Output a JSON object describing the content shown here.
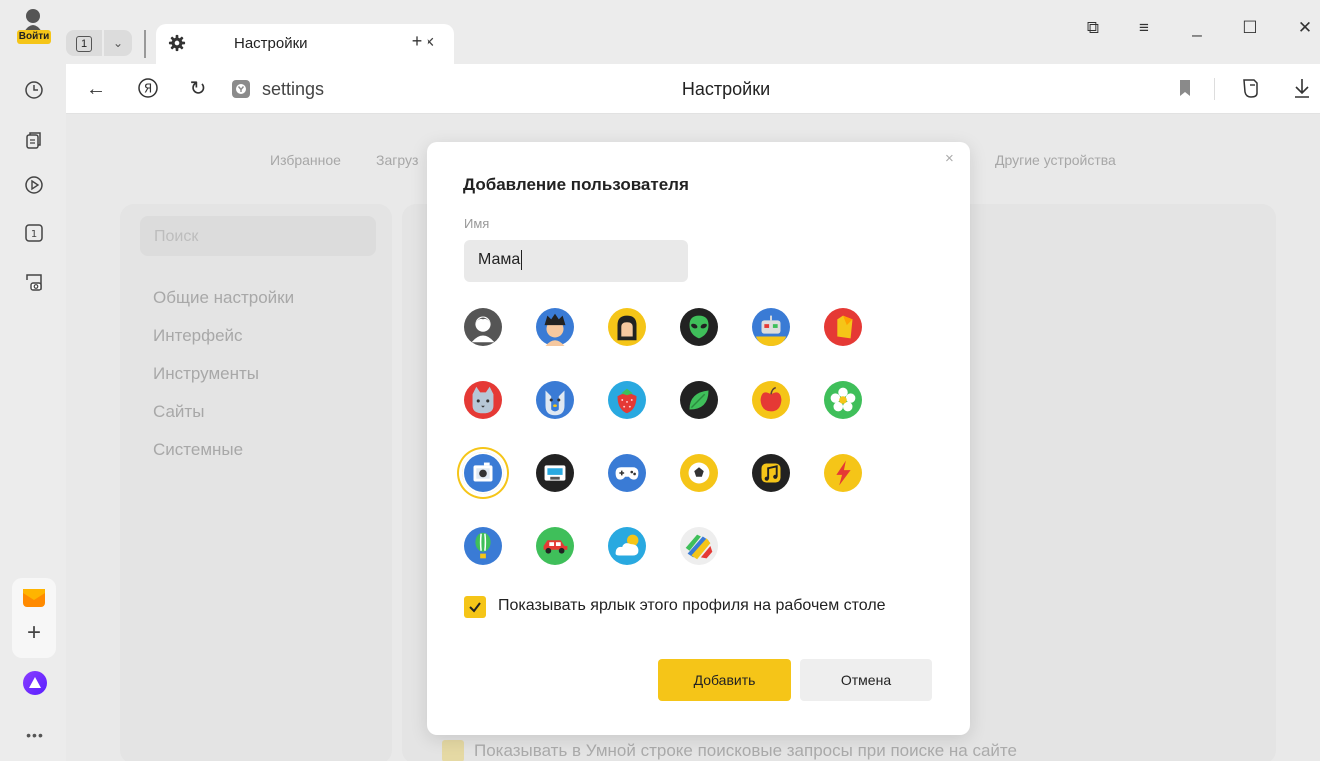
{
  "sidebar": {
    "login_label": "Войти",
    "icons": [
      "history-icon",
      "collections-icon",
      "play-icon",
      "tab-counter-icon",
      "screenshot-icon"
    ],
    "mail_icon": "mail-icon",
    "add_label": "+",
    "more_label": "•••"
  },
  "tabs": {
    "counter": "1",
    "active_title": "Настройки",
    "close": "×",
    "new": "+"
  },
  "window": {
    "collections": "⧉",
    "menu": "≡",
    "minimize": "_",
    "maximize": "☐",
    "close": "✕"
  },
  "addressbar": {
    "back": "←",
    "yandex": "Я",
    "reload": "↻",
    "url": "settings",
    "page_title": "Настройки"
  },
  "settings": {
    "topnav": [
      "Избранное",
      "Загруз",
      "Другие устройства"
    ],
    "search_placeholder": "Поиск",
    "menu": [
      "Общие настройки",
      "Интерфейс",
      "Инструменты",
      "Сайты",
      "Системные"
    ],
    "bg_checkbox_label": "Показывать в Умной строке поисковые запросы при поиске на сайте"
  },
  "dialog": {
    "title": "Добавление пользователя",
    "close": "×",
    "name_label": "Имя",
    "name_value": "Мама",
    "avatars": [
      "avatar-person-icon",
      "avatar-boy-icon",
      "avatar-girl-icon",
      "avatar-alien-icon",
      "avatar-robot-icon",
      "avatar-cat-ear-icon",
      "avatar-red-cat-icon",
      "avatar-blue-dog-icon",
      "avatar-strawberry-icon",
      "avatar-leaf-icon",
      "avatar-apple-icon",
      "avatar-flower-icon",
      "avatar-camera-icon",
      "avatar-tape-icon",
      "avatar-gamepad-icon",
      "avatar-soccer-icon",
      "avatar-music-icon",
      "avatar-lightning-icon",
      "avatar-balloon-icon",
      "avatar-car-icon",
      "avatar-cloud-icon",
      "avatar-paint-icon"
    ],
    "selected_avatar": "avatar-camera-icon",
    "shortcut_label": "Показывать ярлык этого профиля на рабочем столе",
    "shortcut_checked": true,
    "add_button": "Добавить",
    "cancel_button": "Отмена",
    "accent": "#f5c518"
  }
}
